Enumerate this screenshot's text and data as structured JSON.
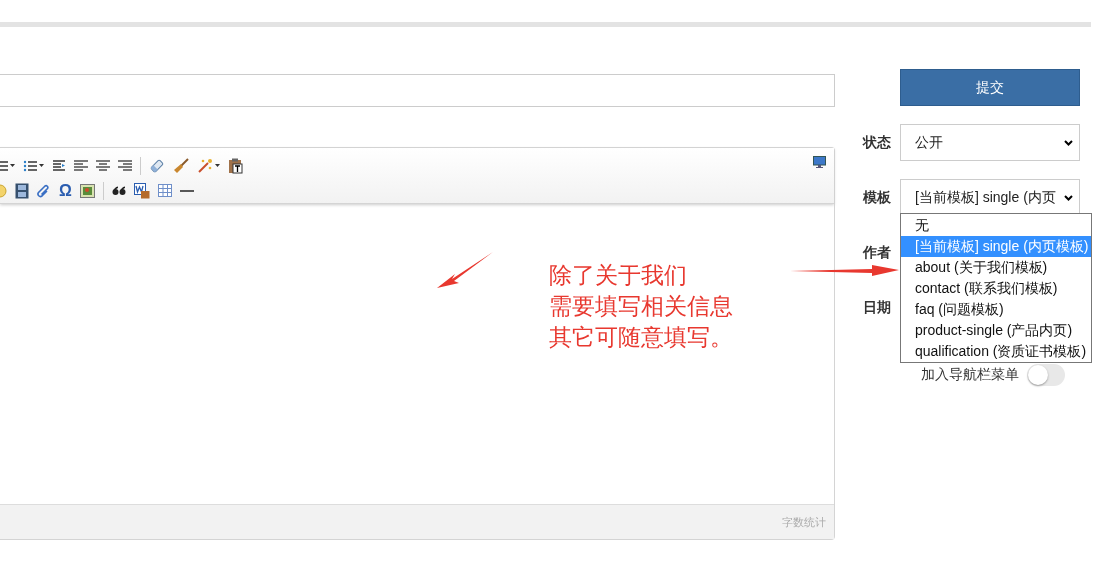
{
  "toolbar": {
    "row_1": [
      {
        "kind": "list-ordered",
        "caret": true
      },
      {
        "kind": "list-bullet",
        "caret": true
      },
      {
        "kind": "indent"
      },
      {
        "kind": "align-left"
      },
      {
        "kind": "align-center"
      },
      {
        "kind": "align-right"
      },
      {
        "kind": "separator"
      },
      {
        "kind": "eraser"
      },
      {
        "kind": "brush"
      },
      {
        "kind": "wand",
        "caret": true
      },
      {
        "kind": "paste-text"
      }
    ],
    "row_2": [
      {
        "kind": "emoticon"
      },
      {
        "kind": "film"
      },
      {
        "kind": "clip"
      },
      {
        "kind": "char",
        "text": "Ω"
      },
      {
        "kind": "image"
      },
      {
        "kind": "separator"
      },
      {
        "kind": "quote"
      },
      {
        "kind": "word-image"
      },
      {
        "kind": "table"
      },
      {
        "kind": "rule"
      }
    ]
  },
  "word_count": "字数统计",
  "submit_button": "提交",
  "fields": [
    {
      "label": "状态",
      "kind": "select",
      "value": "公开"
    },
    {
      "label": "模板",
      "kind": "select",
      "value": "[当前模板] single (内页"
    },
    {
      "label": "作者",
      "kind": "hidden"
    },
    {
      "label": "日期",
      "kind": "hidden"
    }
  ],
  "template_dropdown": {
    "options": [
      {
        "label": "无",
        "selected": false
      },
      {
        "label": "[当前模板] single (内页模板)",
        "selected": true
      },
      {
        "label": "about (关于我们模板)",
        "selected": false
      },
      {
        "label": "contact (联系我们模板)",
        "selected": false
      },
      {
        "label": "faq (问题模板)",
        "selected": false
      },
      {
        "label": "product-single (产品内页)",
        "selected": false
      },
      {
        "label": "qualification (资质证书模板)",
        "selected": false
      }
    ]
  },
  "nav_menu_toggle": {
    "label": "加入导航栏菜单",
    "on": false
  },
  "annotation": {
    "lines": [
      "除了关于我们",
      "需要填写相关信息",
      "其它可随意填写。"
    ]
  }
}
